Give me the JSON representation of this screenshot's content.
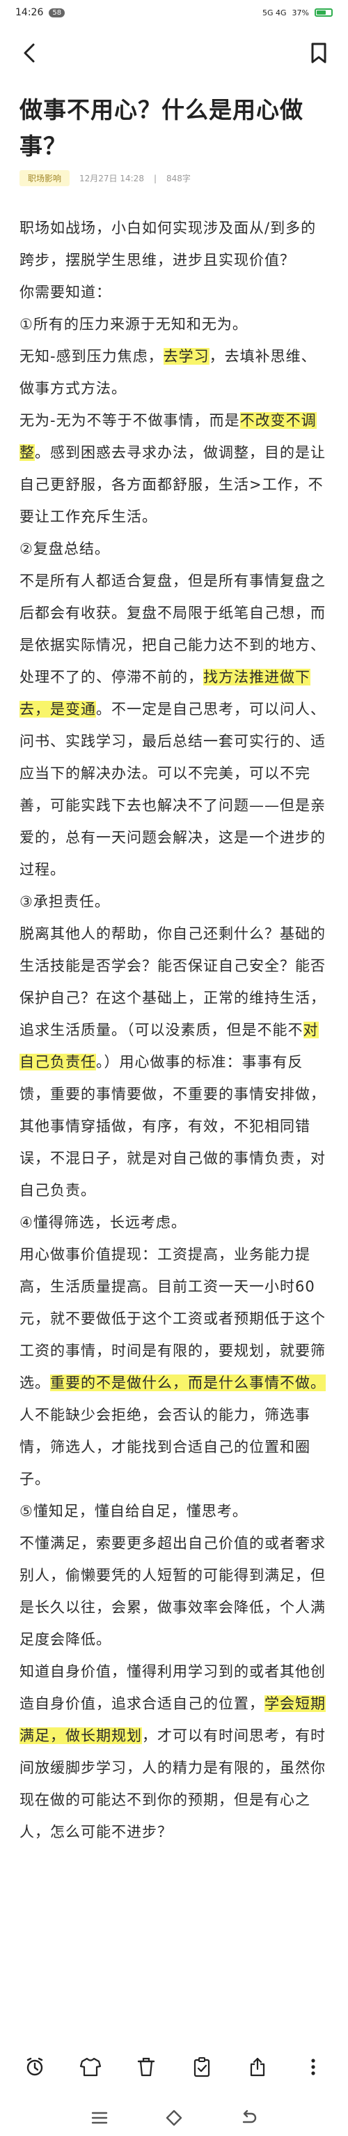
{
  "status_bar": {
    "time": "14:26",
    "notif_badge": "58",
    "signal_text": "5G 4G",
    "battery_text": "37%"
  },
  "article": {
    "title": "做事不用心？什么是用心做事？",
    "tag": "职场影响",
    "date": "12月27日 14:28",
    "word_count": "848字",
    "paragraphs": [
      {
        "parts": [
          {
            "text": "职场如战场，小白如何实现涉及面从/到多的跨步，摆脱学生思维，进步且实现价值？"
          }
        ]
      },
      {
        "parts": [
          {
            "text": "你需要知道："
          }
        ]
      },
      {
        "parts": [
          {
            "text": "①所有的压力来源于无知和无为。"
          }
        ]
      },
      {
        "parts": [
          {
            "text": "无知-感到压力焦虑，"
          },
          {
            "text": "去学习",
            "hl": true
          },
          {
            "text": "，去填补思维、做事方式方法。"
          }
        ]
      },
      {
        "parts": [
          {
            "text": "无为-无为不等于不做事情，而是"
          },
          {
            "text": "不改变不调整",
            "hl": true
          },
          {
            "text": "。感到困惑去寻求办法，做调整，目的是让自己更舒服，各方面都舒服，生活>工作，不要让工作充斥生活。"
          }
        ]
      },
      {
        "parts": [
          {
            "text": "②复盘总结。"
          }
        ]
      },
      {
        "parts": [
          {
            "text": "不是所有人都适合复盘，但是所有事情复盘之后都会有收获。复盘不局限于纸笔自己想，而是依据实际情况，把自己能力达不到的地方、处理不了的、停滞不前的，"
          },
          {
            "text": "找方法推进做下去，是变通",
            "hl": true
          },
          {
            "text": "。不一定是自己思考，可以问人、问书、实践学习，最后总结一套可实行的、适应当下的解决办法。可以不完美，可以不完善，可能实践下去也解决不了问题——但是亲爱的，总有一天问题会解决，这是一个进步的过程。"
          }
        ]
      },
      {
        "parts": [
          {
            "text": "③承担责任。"
          }
        ]
      },
      {
        "parts": [
          {
            "text": "脱离其他人的帮助，你自己还剩什么？基础的生活技能是否学会？能否保证自己安全？能否保护自己？在这个基础上，正常的维持生活，追求生活质量。（可以没素质，但是不能不"
          },
          {
            "text": "对自己负责任",
            "hl": true
          },
          {
            "text": "。）用心做事的标准：事事有反馈，重要的事情要做，不重要的事情安排做，其他事情穿插做，有序，有效，不犯相同错误，不混日子，就是对自己做的事情负责，对自己负责。"
          }
        ]
      },
      {
        "parts": [
          {
            "text": "④懂得筛选，长远考虑。"
          }
        ]
      },
      {
        "parts": [
          {
            "text": "用心做事价值提现：工资提高，业务能力提高，生活质量提高。目前工资一天一小时60元，就不要做低于这个工资或者预期低于这个工资的事情，时间是有限的，要规划，就要筛选。"
          },
          {
            "text": "重要的不是做什么，而是什么事情不做。",
            "hl": true
          },
          {
            "text": "人不能缺少会拒绝，会否认的能力，筛选事情，筛选人，才能找到合适自己的位置和圈子。"
          }
        ]
      },
      {
        "parts": [
          {
            "text": "⑤懂知足，懂自给自足，懂思考。"
          }
        ]
      },
      {
        "parts": [
          {
            "text": "不懂满足，索要更多超出自己价值的或者奢求别人，偷懒要凭的人短暂的可能得到满足，但是长久以往，会累，做事效率会降低，个人满足度会降低。"
          }
        ]
      },
      {
        "parts": [
          {
            "text": "知道自身价值，懂得利用学习到的或者其他创造自身价值，追求合适自己的位置，"
          },
          {
            "text": "学会短期满足，做长期规划",
            "hl": true
          },
          {
            "text": "，才可以有时间思考，有时间放缓脚步学习，人的精力是有限的，虽然你现在做的可能达不到你的预期，但是有心之人，怎么可能不进步？"
          }
        ]
      }
    ]
  }
}
